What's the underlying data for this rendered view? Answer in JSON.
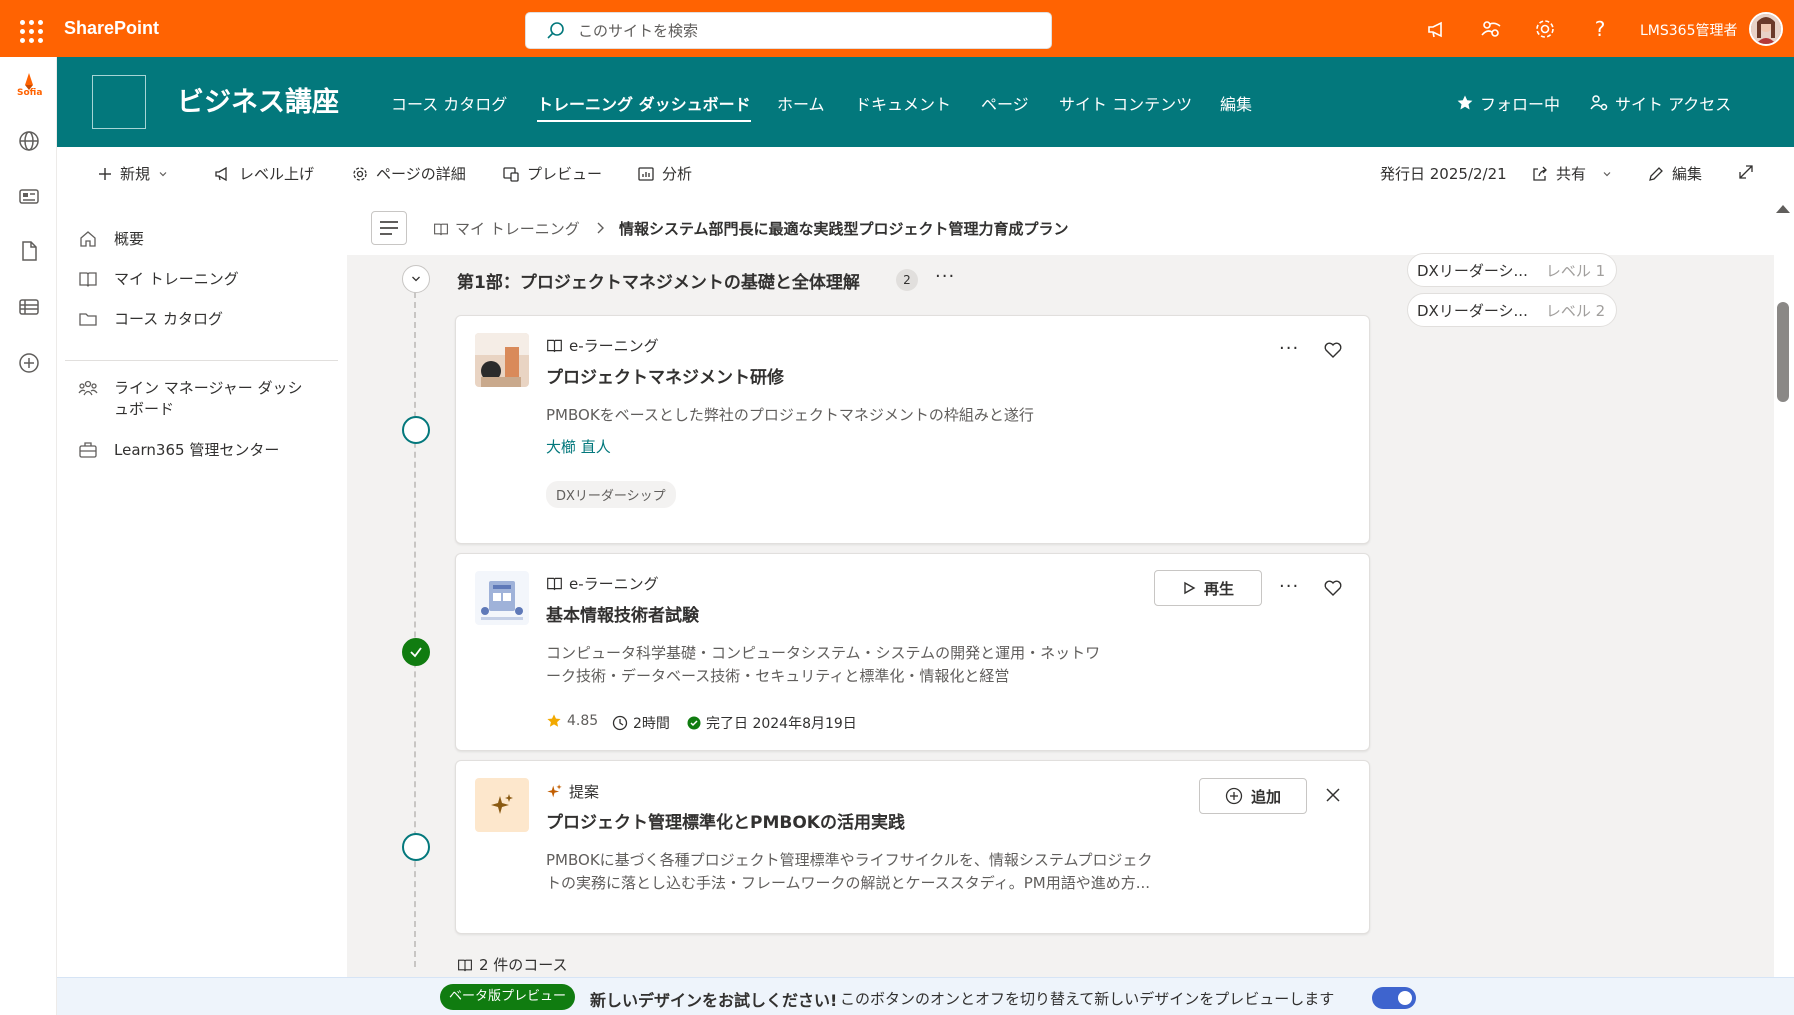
{
  "suite_bar": {
    "app_name": "SharePoint",
    "search_placeholder": "このサイトを検索",
    "user_name": "LMS365管理者"
  },
  "app_bar": {
    "logo_text": "Sofia"
  },
  "site_header": {
    "title": "ビジネス講座",
    "nav": [
      {
        "label": "コース カタログ",
        "active": false
      },
      {
        "label": "トレーニング ダッシュボード",
        "active": true
      },
      {
        "label": "ホーム",
        "active": false
      },
      {
        "label": "ドキュメント",
        "active": false
      },
      {
        "label": "ページ",
        "active": false
      },
      {
        "label": "サイト コンテンツ",
        "active": false
      },
      {
        "label": "編集",
        "active": false
      }
    ],
    "follow_label": "フォロー中",
    "site_access_label": "サイト アクセス"
  },
  "command_bar": {
    "new_label": "新規",
    "promote_label": "レベル上げ",
    "page_details_label": "ページの詳細",
    "preview_label": "プレビュー",
    "analytics_label": "分析",
    "published_label": "発行日 2025/2/21",
    "share_label": "共有",
    "edit_label": "編集"
  },
  "left_nav": {
    "items": [
      {
        "label": "概要",
        "icon": "home-icon"
      },
      {
        "label": "マイ トレーニング",
        "icon": "book-icon"
      },
      {
        "label": "コース カタログ",
        "icon": "folder-icon"
      },
      {
        "label": "ライン マネージャー ダッシュボード",
        "icon": "people-icon"
      },
      {
        "label": "Learn365 管理センター",
        "icon": "briefcase-icon"
      }
    ]
  },
  "breadcrumb": {
    "parent": "マイ トレーニング",
    "current": "情報システム部門長に最適な実践型プロジェクト管理力育成プラン"
  },
  "section": {
    "title": "第1部：プロジェクトマネジメントの基礎と全体理解",
    "count": "2"
  },
  "cards": [
    {
      "kind": "e-ラーニング",
      "title": "プロジェクトマネジメント研修",
      "description": "PMBOKをベースとした弊社のプロジェクトマネジメントの枠組みと遂行",
      "author": "大櫛 直人",
      "tag": "DXリーダーシップ"
    },
    {
      "kind": "e-ラーニング",
      "title": "基本情報技術者試験",
      "description_line1": "コンピュータ科学基礎・コンピュータシステム・システムの開発と運用・ネットワ",
      "description_line2": "ーク技術・データベース技術・セキュリティと標準化・情報化と経営",
      "play_label": "再生",
      "rating": "4.85",
      "duration": "2時間",
      "completed": "完了日 2024年8月19日"
    },
    {
      "kind": "提案",
      "title": "プロジェクト管理標準化とPMBOKの活用実践",
      "description_line1": "PMBOKに基づく各種プロジェクト管理標準やライフサイクルを、情報システムプロジェク",
      "description_line2": "トの実務に落とし込む手法・フレームワークの解説とケーススタディ。PM用語や進め方...",
      "add_label": "追加"
    }
  ],
  "course_count": "2 件のコース",
  "right_panel": {
    "chips": [
      {
        "name": "DXリーダーシ...",
        "level": "レベル 1"
      },
      {
        "name": "DXリーダーシ...",
        "level": "レベル 2"
      }
    ]
  },
  "beta_bar": {
    "badge": "ベータ版プレビュー",
    "headline": "新しいデザインをお試しください!",
    "text": "このボタンのオンとオフを切り替えて新しいデザインをプレビューします",
    "toggle_on": true
  },
  "colors": {
    "suite_bar": "#ff6302",
    "site_header": "#03787c",
    "accent_green": "#107c10",
    "toggle_blue": "#3e64ce"
  }
}
